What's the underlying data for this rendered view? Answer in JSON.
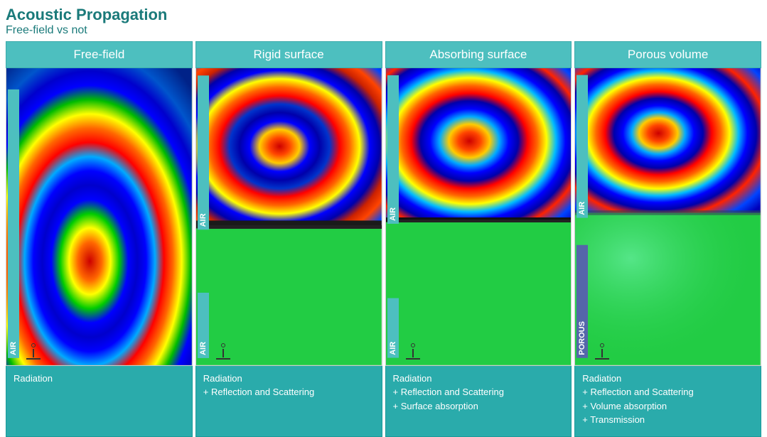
{
  "header": {
    "title": "Acoustic Propagation",
    "subtitle": "Free-field vs not"
  },
  "columns": [
    {
      "id": "free-field",
      "header": "Free-field",
      "air_label": "AIR",
      "has_surface": false,
      "surface_type": "none",
      "caption_lines": [
        "Radiation"
      ]
    },
    {
      "id": "rigid-surface",
      "header": "Rigid surface",
      "air_label": "AIR",
      "has_surface": true,
      "surface_type": "rigid",
      "caption_lines": [
        "Radiation",
        "+ Reflection and Scattering"
      ]
    },
    {
      "id": "absorbing-surface",
      "header": "Absorbing surface",
      "air_label": "AIR",
      "has_surface": true,
      "surface_type": "absorbing",
      "caption_lines": [
        "Radiation",
        "+ Reflection and Scattering",
        "+ Surface absorption"
      ]
    },
    {
      "id": "porous-volume",
      "header": "Porous volume",
      "air_label": "AIR",
      "porous_label": "POROUS",
      "has_surface": true,
      "surface_type": "porous",
      "caption_lines": [
        "Radiation",
        "+ Reflection and Scattering",
        "+ Volume absorption",
        "+ Transmission"
      ]
    }
  ],
  "colors": {
    "header_bg": "#4dbfbf",
    "caption_bg": "#2aabab",
    "title_color": "#1a7a7a"
  }
}
